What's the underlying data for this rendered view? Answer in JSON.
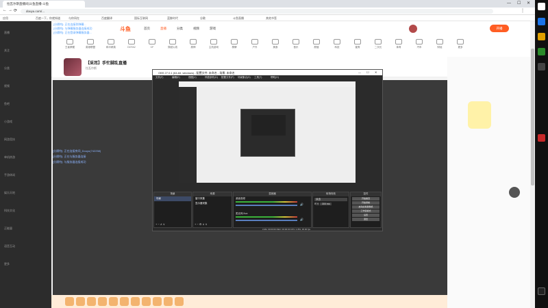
{
  "browser": {
    "tab_title": "拉瓦尔斯直播间|斗鱼直播-斗鱼",
    "url": "douyu.com/...",
    "bookmarks": [
      "应用",
      "百度一下，你就知道",
      "与你同在",
      "百度翻译",
      "国际互联网",
      "蓝鲸时代",
      "谷歌",
      "斗鱼直播",
      "其他书签"
    ]
  },
  "sidebar": {
    "items": [
      "直播",
      "关注",
      "分类",
      "视频",
      "鱼吧",
      "小游戏",
      "网游竞技",
      "单机热游",
      "手游休闲",
      "娱乐天地",
      "科技文化",
      "正能量",
      "语音互动",
      "更多"
    ]
  },
  "topnav": {
    "logo": "斗鱼",
    "items": [
      "首页",
      "直播",
      "分类",
      "视频",
      "游戏"
    ],
    "right_button": "开播"
  },
  "categories": [
    "王者荣耀",
    "英雄联盟",
    "和平精英",
    "DOTA2",
    "CF",
    "穿越火线",
    "原神",
    "主机游戏",
    "棋牌",
    "户外",
    "美食",
    "音乐",
    "颜值",
    "科技",
    "星秀",
    "二次元",
    "体育",
    "汽车",
    "财经",
    "更多"
  ],
  "streamer": {
    "title": "【采耳】手忙脚乱直播",
    "sub": "拉瓦尔斯"
  },
  "overlay_log": [
    "[分隔符]: 正在连接到弹幕...",
    "[分隔符]: 与弹幕服务器连接成功",
    "[分隔符]: 正在登录弹幕服务器..."
  ],
  "chat_lines": [
    "[分隔符]: 正在连接房间_Douyu(742258)",
    "[分隔符]: 正在与服务器连接",
    "[分隔符]: 与服务器连接成功"
  ],
  "obs": {
    "title": "OBS 27.0.1 (64-bit, windows) - 配置文件: 未命名 - 场景: 未命名",
    "menu": [
      "文件(F)",
      "编辑(E)",
      "视图(V)",
      "停靠部件(D)",
      "配置文件(P)",
      "场景集合(S)",
      "工具(T)",
      "帮助(H)"
    ],
    "docks": {
      "scenes": "场景",
      "sources": "来源",
      "mixer": "混音器",
      "transitions": "转场特效",
      "controls": "控件"
    },
    "scene_item": "场景",
    "sources_items": [
      "窗口采集",
      "显示器采集"
    ],
    "mixer_channels": [
      "桌面音频",
      "麦克风/Aux"
    ],
    "transition": "淡出",
    "duration_label": "时长",
    "duration_value": "300 ms",
    "controls": [
      "开始推流",
      "开始录制",
      "启动虚拟摄像机",
      "工作室模式",
      "设置",
      "退出"
    ],
    "status": "LIVE: 00:00:00   REC: 00:00:00   CPU: 2.8%, 30.00 fps"
  },
  "colors": {
    "accent": "#ff5d23",
    "obs_bg": "#2b2b2b",
    "sidebar_bg": "#2c2c2c"
  }
}
